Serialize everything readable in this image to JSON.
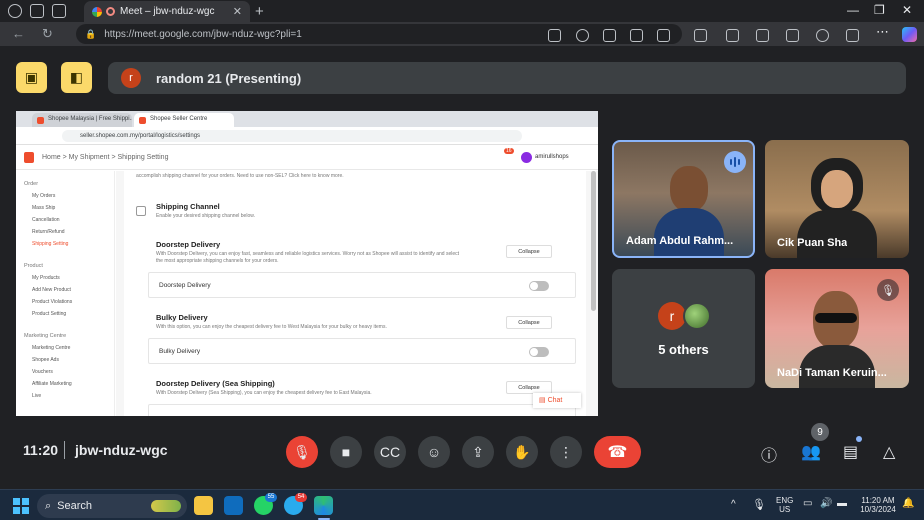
{
  "browser": {
    "tab_title": "Meet – jbw-nduz-wgc",
    "url": "https://meet.google.com/jbw-nduz-wgc?pli=1"
  },
  "meet": {
    "presenter_initial": "r",
    "presenting_label": "random 21 (Presenting)",
    "time": "11:20",
    "meeting_code": "jbw-nduz-wgc",
    "participants_count": "9"
  },
  "tiles": [
    {
      "name": "Adam Abdul Rahm..."
    },
    {
      "name": "Cik Puan Sha"
    },
    {
      "initial": "r",
      "others_label": "5 others"
    },
    {
      "name": "NaDi Taman Keruin..."
    }
  ],
  "shared": {
    "tab1": "Shopee Malaysia | Free Shippi...",
    "tab2": "Shopee Seller Centre",
    "url": "seller.shopee.com.my/portal/logistics/settings",
    "breadcrumb": "Home  >  My Shipment  >  Shipping Setting",
    "username": "amirullshops",
    "notif": "16",
    "top_text": "accomplish shipping channel for your orders. Need to use non-SEL? Click here to know more.",
    "sidebar": [
      {
        "group": "Order",
        "items": [
          "My Orders",
          "Mass Ship",
          "Cancellation",
          "Return/Refund",
          "Shipping Setting"
        ]
      },
      {
        "group": "Product",
        "items": [
          "My Products",
          "Add New Product",
          "Product Violations",
          "Product Setting"
        ]
      },
      {
        "group": "Marketing Centre",
        "items": [
          "Marketing Centre",
          "Shopee Ads",
          "Vouchers",
          "Affiliate Marketing",
          "Live"
        ]
      }
    ],
    "channel_title": "Shipping Channel",
    "channel_sub": "Enable your desired shipping channel below.",
    "sections": [
      {
        "title": "Doorstep Delivery",
        "desc1": "With Doorstep Delivery, you can enjoy fast, seamless and reliable logistics services. Worry not as Shopee will assist to identify and select",
        "desc2": "the most appropriate shipping channels for your orders.",
        "collapse": "Collapse",
        "row": "Doorstep Delivery"
      },
      {
        "title": "Bulky Delivery",
        "desc1": "With this option, you can enjoy the cheapest delivery fee to West Malaysia for your bulky or heavy items.",
        "collapse": "Collapse",
        "row": "Bulky Delivery"
      },
      {
        "title": "Doorstep Delivery (Sea Shipping)",
        "desc1": "With Doorstep Delivery (Sea Shipping), you can enjoy the cheapest delivery fee to East Malaysia.",
        "collapse": "Collapse"
      }
    ],
    "chat": "Chat"
  },
  "taskbar": {
    "search": "Search",
    "lang1": "ENG",
    "lang2": "US",
    "clock_time": "11:20 AM",
    "clock_date": "10/3/2024",
    "whatsapp_badge": "55",
    "telegram_badge": "54"
  }
}
